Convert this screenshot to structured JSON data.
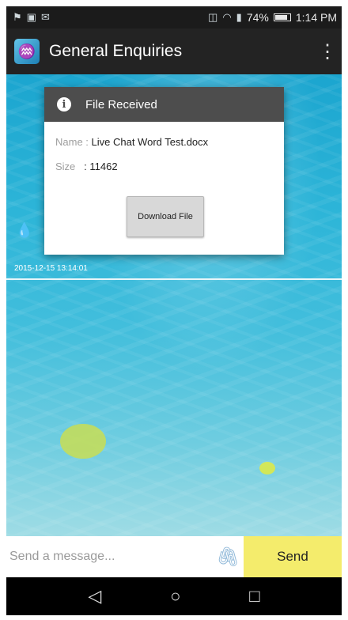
{
  "statusbar": {
    "battery": "74%",
    "time": "1:14 PM",
    "left_icons": [
      "notification-icon",
      "image-icon",
      "mail-icon"
    ],
    "right_icons": [
      "vibrate-icon",
      "wifi-icon",
      "signal-icon",
      "battery-icon"
    ]
  },
  "appbar": {
    "title": "General Enquiries",
    "menu_icon": "overflow-menu-icon"
  },
  "dialog": {
    "title": "File Received",
    "name_label": "Name : ",
    "name_value": "Live Chat Word Test.docx",
    "size_label": "Size",
    "size_value": ": 11462",
    "download_label": "Download File"
  },
  "chat": {
    "timestamp": "2015-12-15 13:14:01"
  },
  "input": {
    "placeholder": "Send a message...",
    "send_label": "Send"
  },
  "colors": {
    "appbar": "#232323",
    "dialog_header": "#4d4d4d",
    "send_button": "#f4ec6c",
    "water": "#2db5d8"
  }
}
